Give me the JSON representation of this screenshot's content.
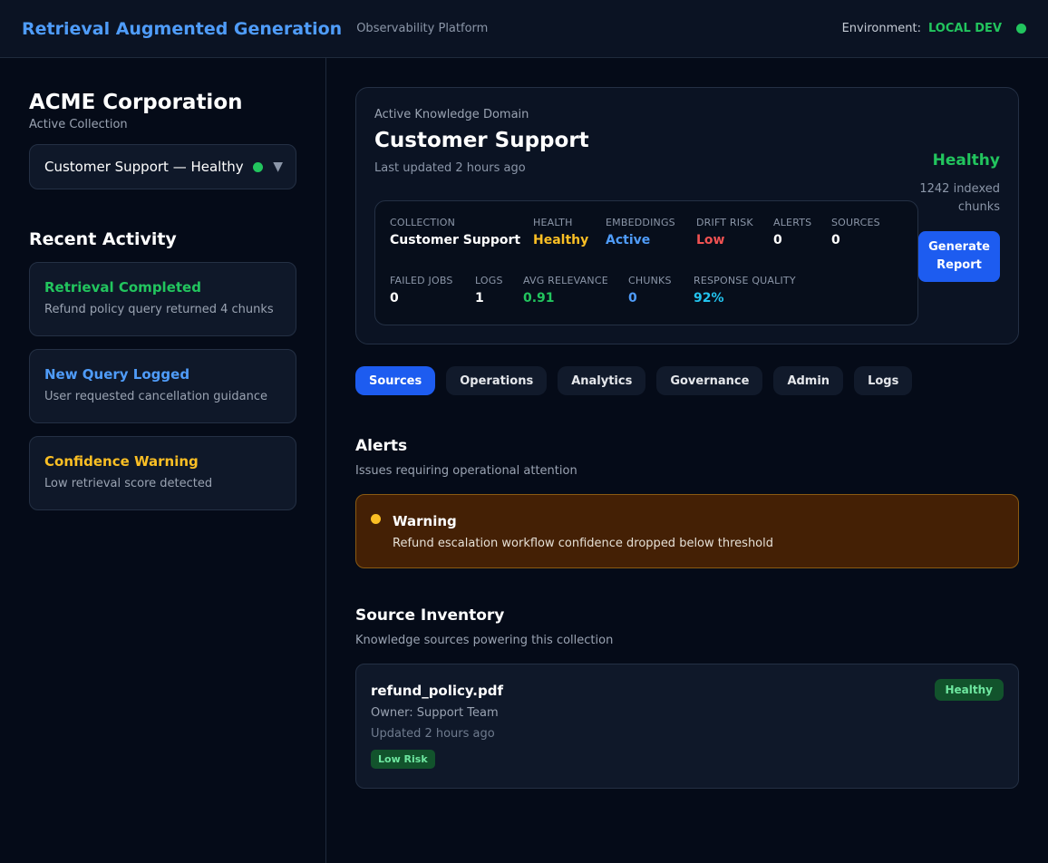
{
  "header": {
    "title": "Retrieval Augmented Generation",
    "subtitle": "Observability Platform",
    "env_label": "Environment:",
    "env_value": "LOCAL DEV"
  },
  "sidebar": {
    "org_name": "ACME Corporation",
    "org_sub": "Active Collection",
    "collection_select": {
      "value": "Customer Support — Healthy",
      "status_icon": "green-dot",
      "caret_icon": "triangle-down"
    },
    "recent_title": "Recent Activity",
    "activities": [
      {
        "title": "Retrieval Completed",
        "desc": "Refund policy query returned 4 chunks",
        "color": "#22c55e"
      },
      {
        "title": "New Query Logged",
        "desc": "User requested cancellation guidance",
        "color": "#4f9cf9"
      },
      {
        "title": "Confidence Warning",
        "desc": "Low retrieval score detected",
        "color": "#fbbf24"
      }
    ]
  },
  "domain": {
    "eyebrow": "Active Knowledge Domain",
    "title": "Customer Support",
    "updated": "Last updated 2 hours ago",
    "status": "Healthy",
    "chunks_line1": "1242 indexed",
    "chunks_line2": "chunks",
    "generate_line1": "Generate",
    "generate_line2": "Report",
    "stats": [
      {
        "label": "COLLECTION",
        "value": "Customer Support"
      },
      {
        "label": "HEALTH",
        "value": "Healthy"
      },
      {
        "label": "EMBEDDINGS",
        "value": "Active"
      },
      {
        "label": "DRIFT RISK",
        "value": "Low"
      },
      {
        "label": "ALERTS",
        "value": "0"
      },
      {
        "label": "SOURCES",
        "value": "0"
      },
      {
        "label": "FAILED JOBS",
        "value": "0"
      },
      {
        "label": "LOGS",
        "value": "1"
      },
      {
        "label": "AVG RELEVANCE",
        "value": "0.91"
      },
      {
        "label": "CHUNKS",
        "value": "0"
      },
      {
        "label": "RESPONSE QUALITY",
        "value": "92%"
      }
    ]
  },
  "tabs": [
    {
      "label": "Sources",
      "active": true
    },
    {
      "label": "Operations",
      "active": false
    },
    {
      "label": "Analytics",
      "active": false
    },
    {
      "label": "Governance",
      "active": false
    },
    {
      "label": "Admin",
      "active": false
    },
    {
      "label": "Logs",
      "active": false
    }
  ],
  "alerts": {
    "title": "Alerts",
    "subtitle": "Issues requiring operational attention",
    "items": [
      {
        "title": "Warning",
        "desc": "Refund escalation workflow confidence dropped below threshold",
        "icon": "amber-dot"
      }
    ]
  },
  "inventory": {
    "title": "Source Inventory",
    "subtitle": "Knowledge sources powering this collection",
    "items": [
      {
        "name": "refund_policy.pdf",
        "owner": "Owner: Support Team",
        "updated": "Updated 2 hours ago",
        "risk": "Low Risk",
        "health": "Healthy"
      }
    ]
  },
  "colors": {
    "accent": "#1d5cf0",
    "title_blue": "#4f9cf9",
    "healthy": "#22c55e",
    "warning": "#fbbf24",
    "danger": "#f05252",
    "cyan": "#22c3ee"
  }
}
